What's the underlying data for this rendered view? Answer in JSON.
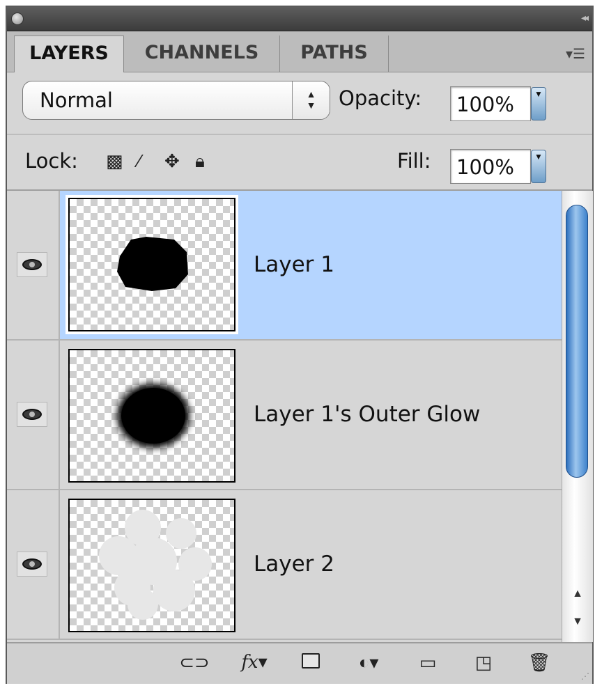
{
  "tabs": [
    {
      "label": "LAYERS",
      "active": true
    },
    {
      "label": "CHANNELS",
      "active": false
    },
    {
      "label": "PATHS",
      "active": false
    }
  ],
  "blend": {
    "mode": "Normal",
    "opacity_label": "Opacity:",
    "opacity_value": "100%"
  },
  "lock": {
    "label": "Lock:",
    "fill_label": "Fill:",
    "fill_value": "100%"
  },
  "layers": [
    {
      "name": "Layer 1",
      "visible": true,
      "selected": true
    },
    {
      "name": "Layer 1's Outer Glow",
      "visible": true,
      "selected": false
    },
    {
      "name": "Layer 2",
      "visible": true,
      "selected": false
    }
  ],
  "colors": {
    "selection": "#b5d5ff",
    "panel": "#d6d6d6",
    "scroll_thumb": "#3e82cc"
  },
  "bottom_icons": [
    "link-icon",
    "fx-icon",
    "mask-icon",
    "adjustment-icon",
    "folder-icon",
    "new-layer-icon",
    "trash-icon"
  ],
  "fx_text": "fx"
}
